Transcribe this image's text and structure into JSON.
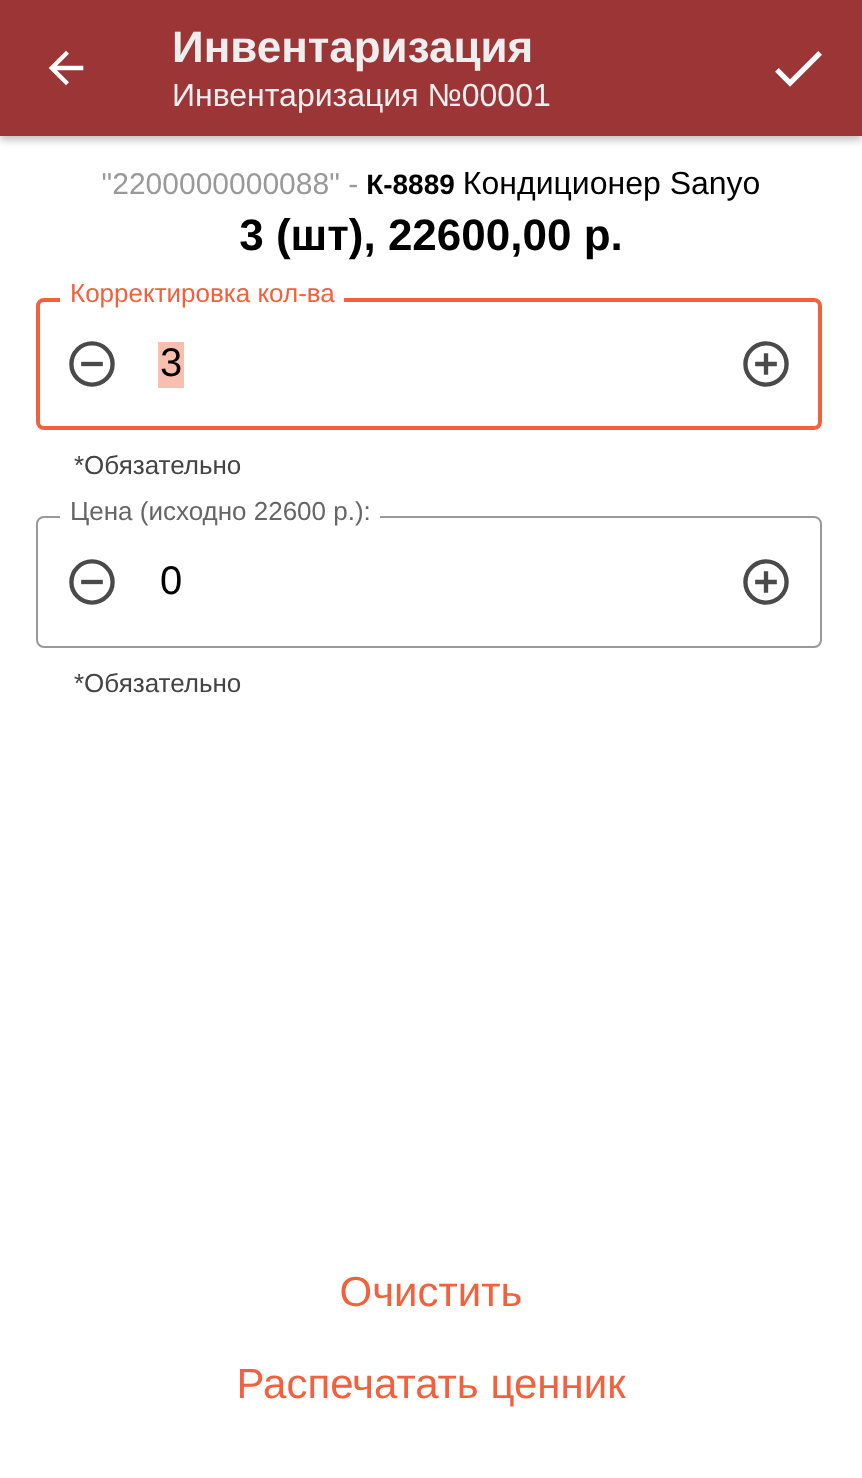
{
  "app_bar": {
    "title": "Инвентаризация",
    "subtitle": "Инвентаризация №00001"
  },
  "product": {
    "barcode": "\"2200000000088\" -",
    "article": "К-8889",
    "name": "Кондиционер Sanyo",
    "summary": "3 (шт), 22600,00 р."
  },
  "fields": [
    {
      "label": "Корректировка кол-ва",
      "value": "3",
      "focused": true,
      "helper": "*Обязательно"
    },
    {
      "label": "Цена (исходно 22600 р.):",
      "value": "0",
      "focused": false,
      "helper": "*Обязательно"
    }
  ],
  "actions": [
    "Очистить",
    "Распечатать ценник"
  ]
}
